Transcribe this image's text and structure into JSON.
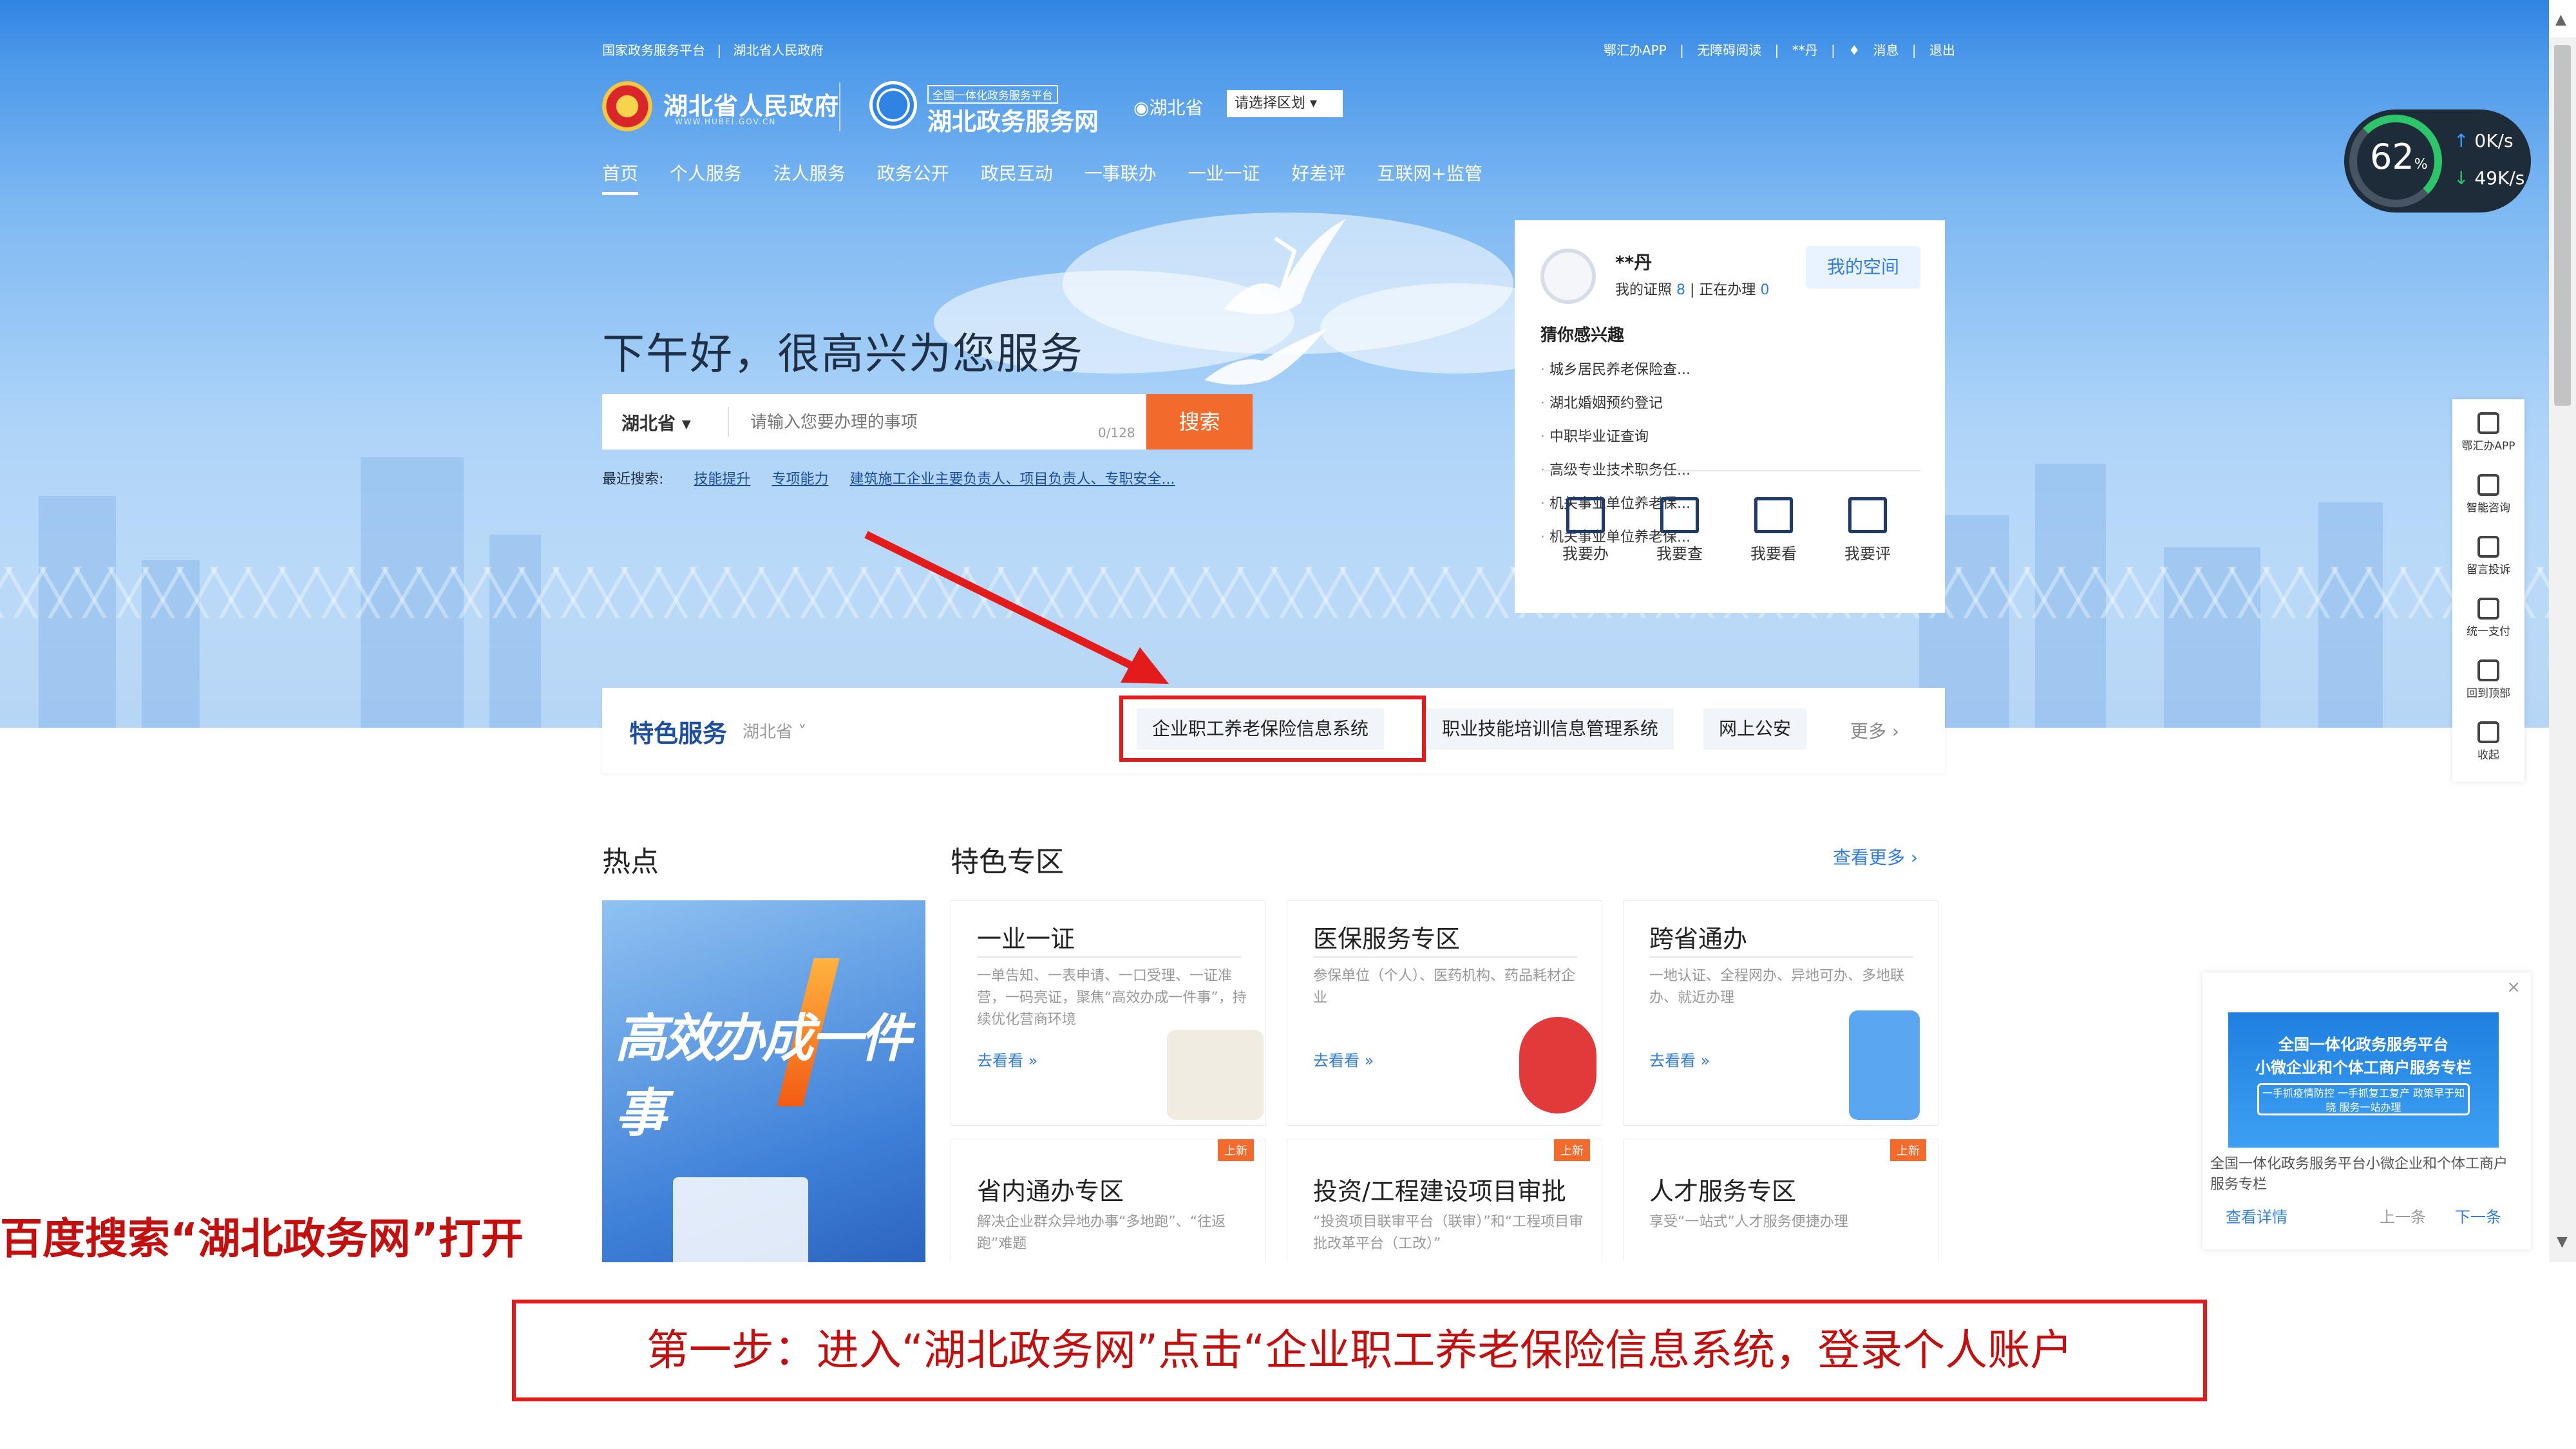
{
  "header": {
    "top_links": [
      "国家政务服务平台",
      "|",
      "湖北省人民政府"
    ],
    "top_right": [
      "鄂汇办APP",
      "|",
      "无障碍阅读",
      "|",
      "**丹",
      "|",
      "消息",
      "|",
      "退出"
    ],
    "site_title": "湖北省人民政府",
    "site_sub": "WWW.HUBEI.GOV.CN",
    "portal_top": "全国一体化政务服务平台",
    "portal_name": "湖北政务服务网",
    "location": "湖北省",
    "region_select": "请选择区划 ▾"
  },
  "nav": [
    "首页",
    "个人服务",
    "法人服务",
    "政务公开",
    "政民互动",
    "一事联办",
    "一业一证",
    "好差评",
    "互联网+监管"
  ],
  "hero": {
    "greeting": "下午好，很高兴为您服务",
    "search_province": "湖北省 ▾",
    "search_placeholder": "请输入您要办理的事项",
    "search_count": "0/128",
    "search_button": "搜索",
    "recent_label": "最近搜索:",
    "recent_items": [
      "技能提升",
      "专项能力",
      "建筑施工企业主要负责人、项目负责人、专职安全..."
    ]
  },
  "user_card": {
    "name": "**丹",
    "certs_label": "我的证照",
    "certs_count": "8",
    "processing_label": "正在办理",
    "processing_count": "0",
    "my_space": "我的空间",
    "guess_title": "猜你感兴趣",
    "guess_items": [
      "城乡居民养老保险查...",
      "湖北婚姻预约登记",
      "中职毕业证查询",
      "高级专业技术职务任...",
      "机关事业单位养老保...",
      "机关事业单位养老保..."
    ],
    "quick": [
      "我要办",
      "我要查",
      "我要看",
      "我要评"
    ]
  },
  "special_services": {
    "title": "特色服务",
    "province": "湖北省 ˅",
    "items": [
      "企业职工养老保险信息系统",
      "职业技能培训信息管理系统",
      "网上公安"
    ],
    "more": "更多 ›"
  },
  "sections": {
    "hot": "热点",
    "featured": "特色专区",
    "see_more": "查看更多 ›",
    "hot_image_text": "高效办成一件事"
  },
  "featured_cards": [
    {
      "title": "一业一证",
      "desc": "一单告知、一表申请、一口受理、一证准营，一码亮证，聚焦“高效办成一件事”，持续优化营商环境",
      "go": "去看看 »"
    },
    {
      "title": "医保服务专区",
      "desc": "参保单位（个人）、医药机构、药品耗材企业",
      "go": "去看看 »"
    },
    {
      "title": "跨省通办",
      "desc": "一地认证、全程网办、异地可办、多地联办、就近办理",
      "go": "去看看 »"
    }
  ],
  "featured_cards_row2": [
    {
      "title": "省内通办专区",
      "desc": "解决企业群众异地办事“多地跑”、“往返跑”难题",
      "badge": "上新"
    },
    {
      "title": "投资/工程建设项目审批",
      "desc": "“投资项目联审平台（联审）”和“工程项目审批改革平台（工改）”",
      "badge": "上新"
    },
    {
      "title": "人才服务专区",
      "desc": "享受“一站式”人才服务便捷办理",
      "badge": "上新"
    }
  ],
  "speed_widget": {
    "percent": "62",
    "unit": "%",
    "up": "0K/s",
    "down": "49K/s"
  },
  "right_sidebar": [
    "鄂汇办APP",
    "智能咨询",
    "留言投诉",
    "统一支付",
    "回到顶部",
    "收起"
  ],
  "promo": {
    "close": "×",
    "banner_line1": "全国一体化政务服务平台",
    "banner_line2": "小微企业和个体工商户服务专栏",
    "banner_line3": "一手抓疫情防控 一手抓复工复产  政策早于知晓 服务一站办理",
    "desc": "全国一体化政务服务平台小微企业和个体工商户服务专栏",
    "link": "查看详情",
    "prev": "上一条",
    "next": "下一条"
  },
  "annotations": {
    "left_caption": "百度搜索“湖北政务网”打开",
    "step_box": "第一步：进入“湖北政务网”点击“企业职工养老保险信息系统，登录个人账户"
  },
  "colors": {
    "accent": "#2f84e3",
    "search_button": "#f36b2c",
    "annotation_red": "#e31b1b"
  }
}
